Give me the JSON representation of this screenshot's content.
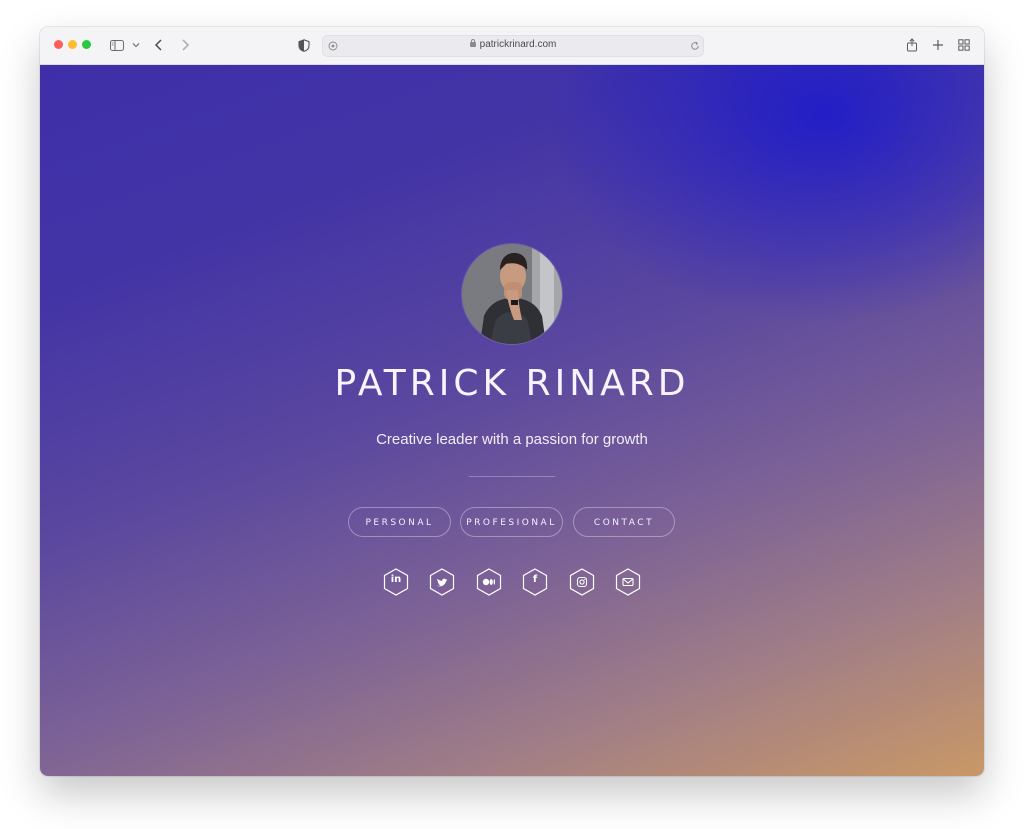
{
  "browser": {
    "url": "patrickrinard.com",
    "colors": {
      "close": "#ff5f57",
      "minimize": "#febc2e",
      "maximize": "#28c840"
    },
    "icons": [
      "sidebar-icon",
      "chevron-down-icon",
      "back-arrow-icon",
      "forward-arrow-icon",
      "shield-icon",
      "extension-icon",
      "reload-icon",
      "share-icon",
      "new-tab-icon",
      "tab-overview-icon"
    ]
  },
  "profile": {
    "name": "PATRICK RINARD",
    "tagline": "Creative leader with a passion for growth"
  },
  "nav": {
    "personal": "PERSONAL",
    "professional": "PROFESIONAL",
    "contact": "CONTACT"
  },
  "social": {
    "linkedin": "in",
    "facebook": "f",
    "icons": [
      "linkedin-icon",
      "twitter-icon",
      "medium-icon",
      "facebook-icon",
      "instagram-icon",
      "email-icon"
    ]
  },
  "theme": {
    "gradient_top": "#3e2fa9",
    "gradient_bottom": "#c99866",
    "accent_blue": "#1414d2",
    "text": "#f7f4ff"
  }
}
